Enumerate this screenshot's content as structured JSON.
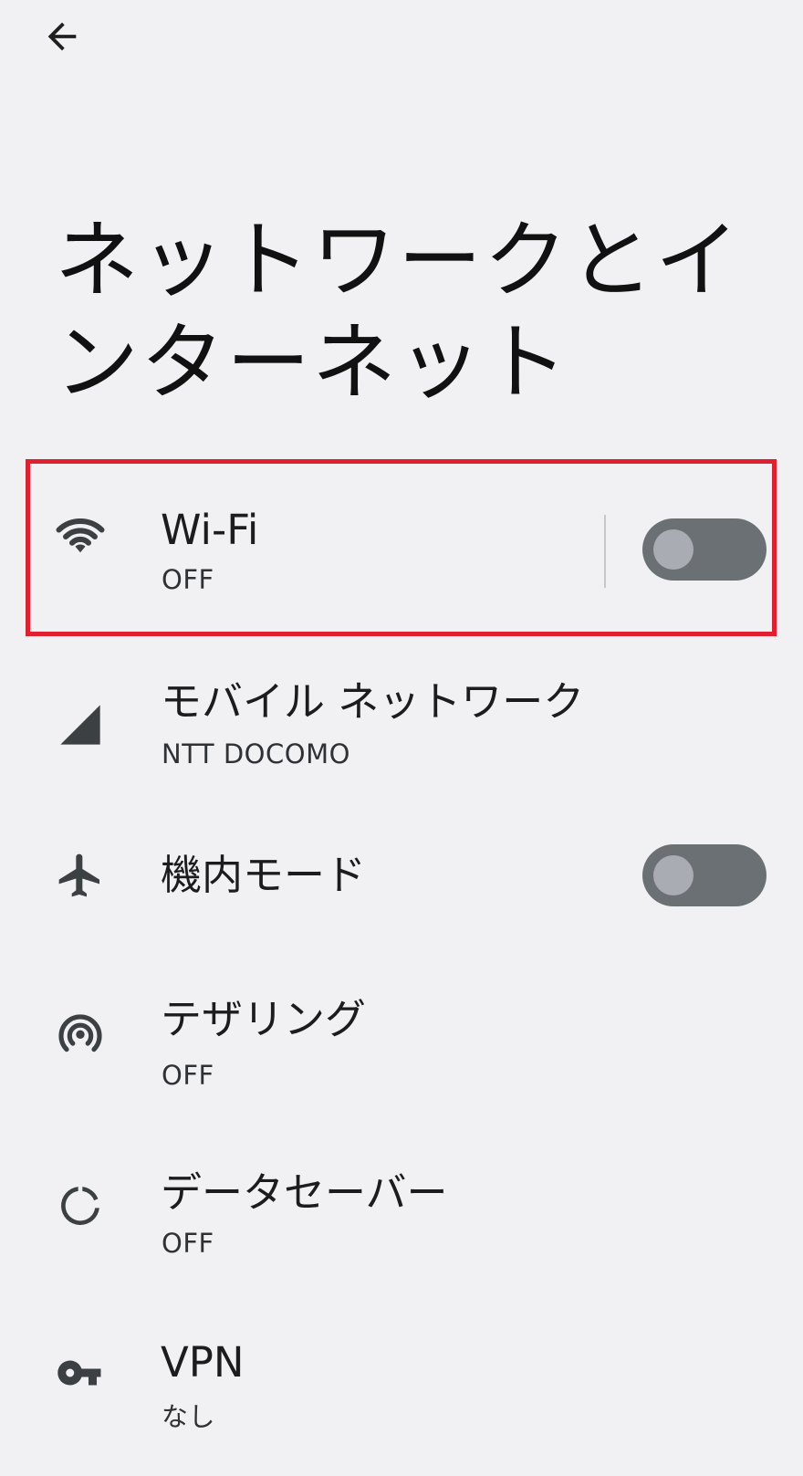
{
  "header": {
    "back_icon": "arrow-back-icon",
    "title": "ネットワークとインターネット"
  },
  "items": [
    {
      "id": "wifi",
      "icon": "wifi-icon",
      "title": "Wi-Fi",
      "summary": "OFF",
      "toggle": false
    },
    {
      "id": "mobile",
      "icon": "cell-signal-icon",
      "title": "モバイル ネットワーク",
      "summary": "NTT DOCOMO"
    },
    {
      "id": "airplane",
      "icon": "airplane-icon",
      "title": "機内モード",
      "toggle": false
    },
    {
      "id": "tethering",
      "icon": "hotspot-icon",
      "title": "テザリング",
      "summary": "OFF"
    },
    {
      "id": "datasaver",
      "icon": "data-saver-icon",
      "title": "データセーバー",
      "summary": "OFF"
    },
    {
      "id": "vpn",
      "icon": "key-icon",
      "title": "VPN",
      "summary": "なし"
    }
  ],
  "colors": {
    "background": "#f1f1f4",
    "toggle_track_off": "#6b7075",
    "toggle_knob_off": "#a9adb3",
    "highlight": "#e0202e",
    "icon": "#3c4043"
  }
}
